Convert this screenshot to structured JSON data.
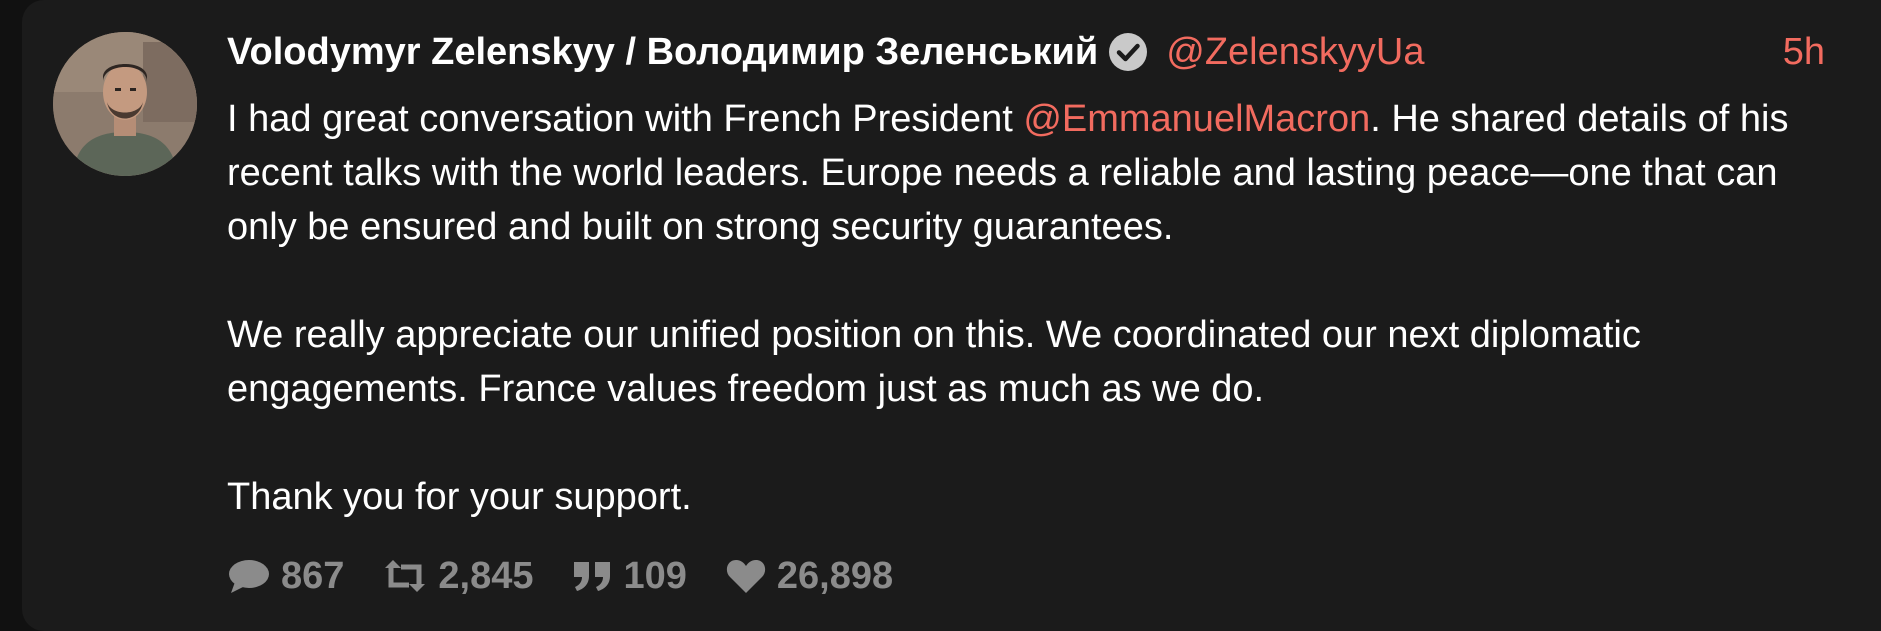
{
  "post": {
    "author_name": "Volodymyr Zelenskyy / Володимир Зеленський",
    "handle": "@ZelenskyyUa",
    "time": "5h",
    "verified_icon": "verified-check-icon",
    "body": {
      "p1_before": "I had great conversation with French President ",
      "p1_mention": "@EmmanuelMacron",
      "p1_after": ". He shared details of his recent talks with the world leaders. Europe needs a reliable and lasting peace—one that can only be ensured and built on strong security guarantees.",
      "p2": "We really appreciate our unified position on this. We coordinated our next diplomatic engagements. France values freedom just as much as we do.",
      "p3": "Thank you for your support."
    },
    "stats": {
      "replies": "867",
      "reposts": "2,845",
      "quotes": "109",
      "likes": "26,898"
    }
  },
  "colors": {
    "background": "#1b1b1b",
    "accent": "#f26b5f",
    "text": "#ffffff",
    "muted": "#8b8b8b"
  }
}
